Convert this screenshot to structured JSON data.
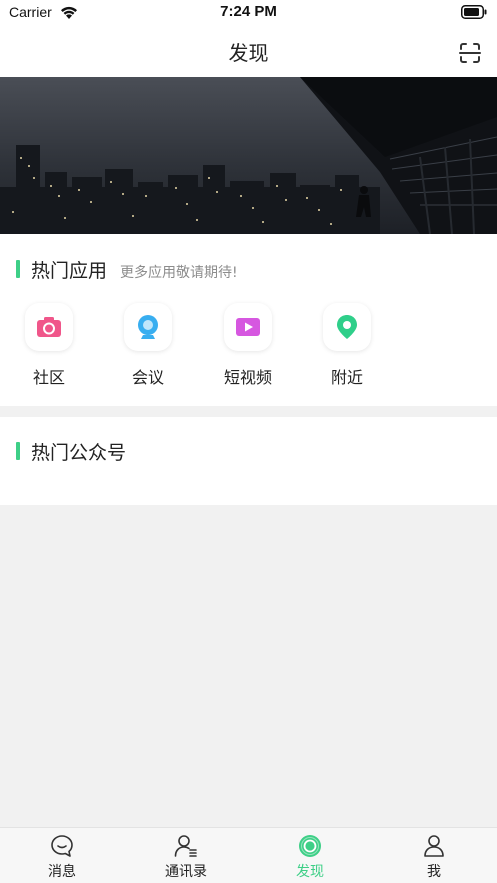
{
  "status_bar": {
    "carrier": "Carrier",
    "time": "7:24 PM"
  },
  "nav": {
    "title": "发现",
    "scan_icon": "scan-icon"
  },
  "banner": {
    "image": "night-city-skyline-photo"
  },
  "hot_apps": {
    "title": "热门应用",
    "subtitle": "更多应用敬请期待!",
    "accent_color": "#3ecf87",
    "items": [
      {
        "label": "社区",
        "icon": "camera-icon",
        "color": "#f0568a"
      },
      {
        "label": "会议",
        "icon": "webcam-icon",
        "color": "#38aef0"
      },
      {
        "label": "短视频",
        "icon": "video-play-icon",
        "color": "#d657e0"
      },
      {
        "label": "附近",
        "icon": "location-pin-icon",
        "color": "#2fcf8a"
      }
    ]
  },
  "hot_accounts": {
    "title": "热门公众号"
  },
  "tab_bar": {
    "active_color": "#3ecf87",
    "tabs": [
      {
        "label": "消息",
        "icon": "chat-bubble-icon",
        "active": false
      },
      {
        "label": "通讯录",
        "icon": "contacts-icon",
        "active": false
      },
      {
        "label": "发现",
        "icon": "discover-icon",
        "active": true
      },
      {
        "label": "我",
        "icon": "profile-icon",
        "active": false
      }
    ]
  }
}
